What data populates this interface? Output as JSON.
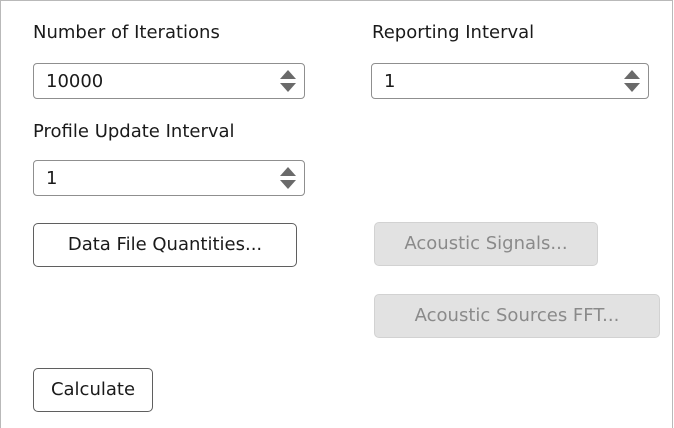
{
  "fields": {
    "iterations": {
      "label": "Number of Iterations",
      "value": "10000"
    },
    "reporting": {
      "label": "Reporting Interval",
      "value": "1"
    },
    "profile": {
      "label": "Profile Update Interval",
      "value": "1"
    }
  },
  "buttons": {
    "data_file": "Data File Quantities...",
    "acoustic_signals": "Acoustic Signals...",
    "acoustic_fft": "Acoustic Sources FFT...",
    "calculate": "Calculate"
  },
  "icons": {
    "spinner_up": "triangle-up",
    "spinner_down": "triangle-down"
  },
  "colors": {
    "panel_bg": "#ffffff",
    "disabled_button_bg": "#e2e2e2",
    "disabled_text": "#8a8a8a"
  }
}
